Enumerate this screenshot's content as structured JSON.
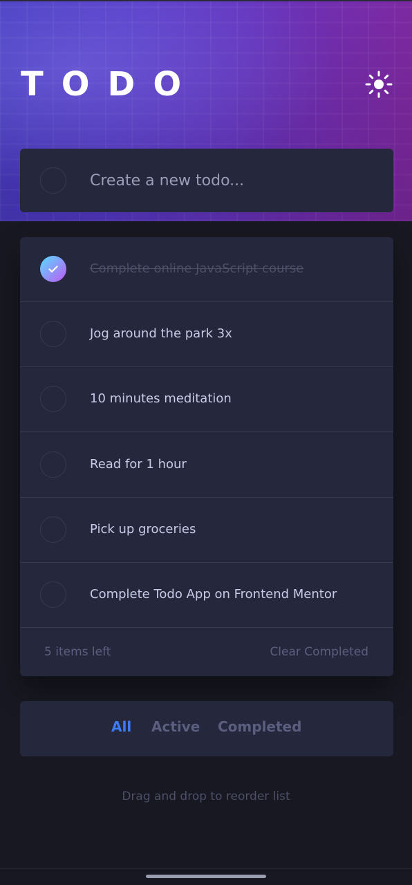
{
  "header": {
    "title": "TODO",
    "theme_icon": "sun-icon"
  },
  "new_todo": {
    "placeholder": "Create a new todo..."
  },
  "todos": [
    {
      "text": "Complete online JavaScript course",
      "completed": true
    },
    {
      "text": "Jog around the park 3x",
      "completed": false
    },
    {
      "text": "10 minutes meditation",
      "completed": false
    },
    {
      "text": "Read for 1 hour",
      "completed": false
    },
    {
      "text": "Pick up groceries",
      "completed": false
    },
    {
      "text": "Complete Todo App on Frontend Mentor",
      "completed": false
    }
  ],
  "footer": {
    "items_left": "5 items left",
    "clear_label": "Clear Completed"
  },
  "filters": {
    "all": "All",
    "active": "Active",
    "completed": "Completed",
    "selected": "All"
  },
  "hint": "Drag and drop to reorder list",
  "colors": {
    "background": "#171821",
    "card": "#25273c",
    "accent": "#3a7cfd",
    "check_gradient_start": "#57ddff",
    "check_gradient_end": "#c058f3"
  }
}
